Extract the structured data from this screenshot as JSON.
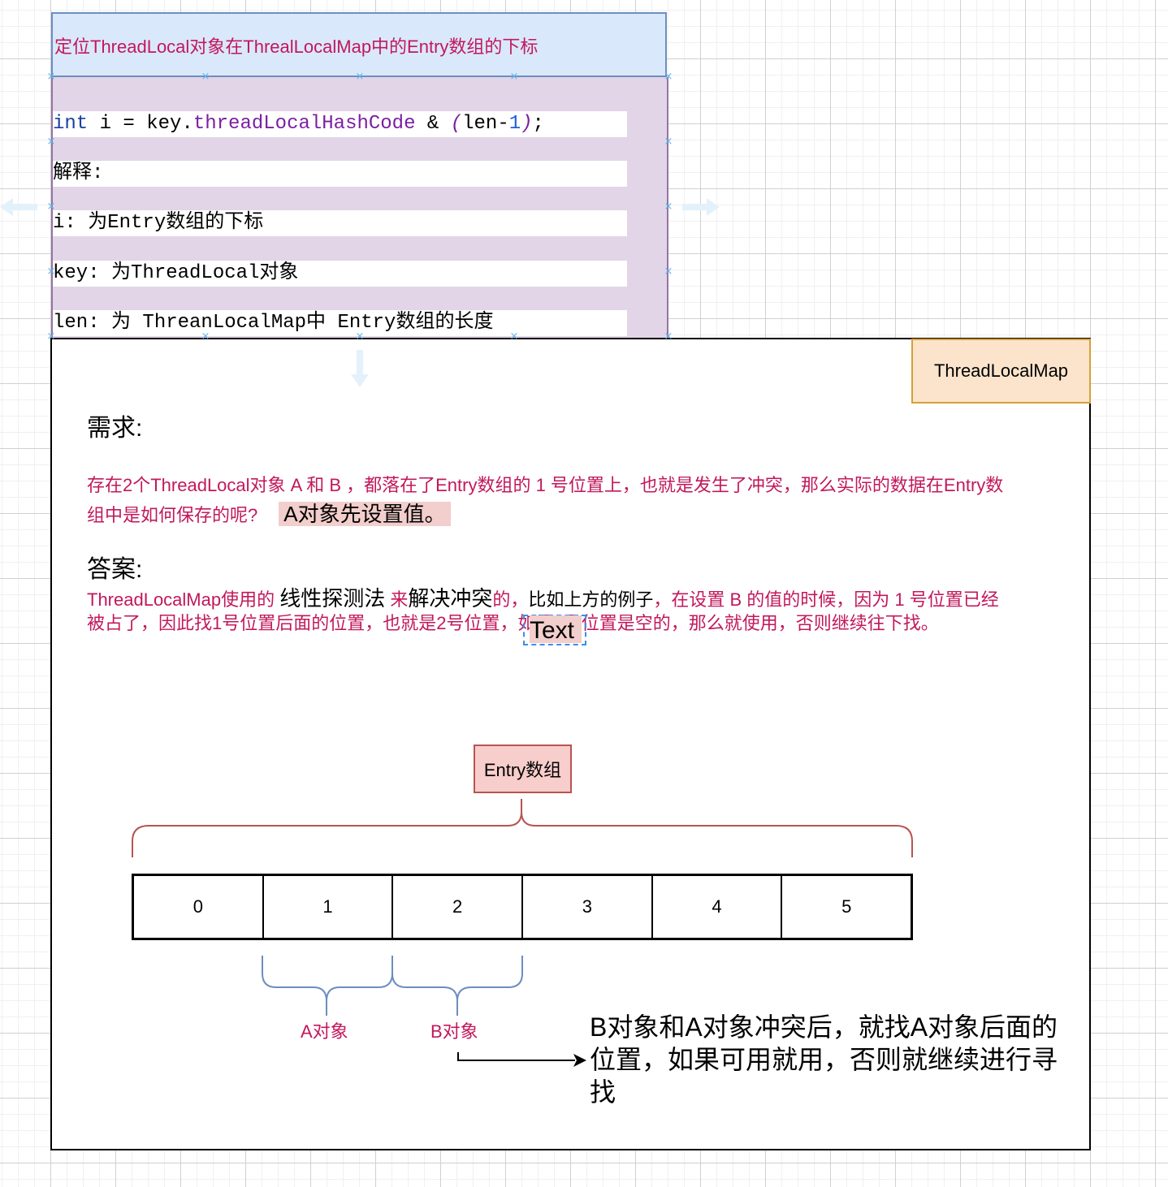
{
  "title_box": {
    "text": "定位ThreadLocal对象在ThrealLocalMap中的Entry数组的下标"
  },
  "code_box": {
    "code_line": {
      "kw_int": "int",
      "var_part": " i = key.",
      "field": "threadLocalHashCode",
      "op": " & ",
      "paren_open": "(",
      "len_part": "len-",
      "num": "1",
      "paren_close": ")",
      "semicolon": ";"
    },
    "lines": [
      "解释:",
      "i: 为Entry数组的下标",
      "key: 为ThreadLocal对象",
      "len: 为 ThreanLocalMap中 Entry数组的长度"
    ]
  },
  "main": {
    "badge": "ThreadLocalMap",
    "requirement_heading": "需求:",
    "requirement_text_1": "存在2个ThreadLocal对象 A 和 B ，都落在了Entry数组的 1 号位置上，也就是发生了冲突，那么实际的数据在Entry数",
    "requirement_text_2": "组中是如何保存的呢?",
    "requirement_highlight": "A对象先设置值。",
    "answer_heading": "答案:",
    "answer_line1": {
      "part1": "ThreadLocalMap使用的 ",
      "part2": "线性探测法",
      "part3": " 来",
      "part4": "解决冲突",
      "part5": "的，",
      "part6": "比如上方的例子",
      "part7": "，在设置 B 的值的时候，因为 1 号位置已经"
    },
    "answer_line2": "被占了，因此找1号位置后面的位置，也就是2号位置，如果2号位置是空的，那么就使用，否则继续往下找。",
    "text_placeholder": "Text",
    "entry_label": "Entry数组",
    "array_cells": [
      "0",
      "1",
      "2",
      "3",
      "4",
      "5"
    ],
    "a_label": "A对象",
    "b_label": "B对象",
    "explanation": "B对象和A对象冲突后，就找A对象后面的位置，如果可用就用，否则就继续进行寻找"
  },
  "colors": {
    "title_fill": "#dae8fc",
    "title_stroke": "#6c8ebf",
    "code_fill": "#e1d5e7",
    "code_stroke": "#9673a6",
    "badge_fill": "#fce4cc",
    "badge_stroke": "#d6a039",
    "entry_fill": "#f8cecc",
    "entry_stroke": "#b85450",
    "accent_text": "#c2185b"
  }
}
